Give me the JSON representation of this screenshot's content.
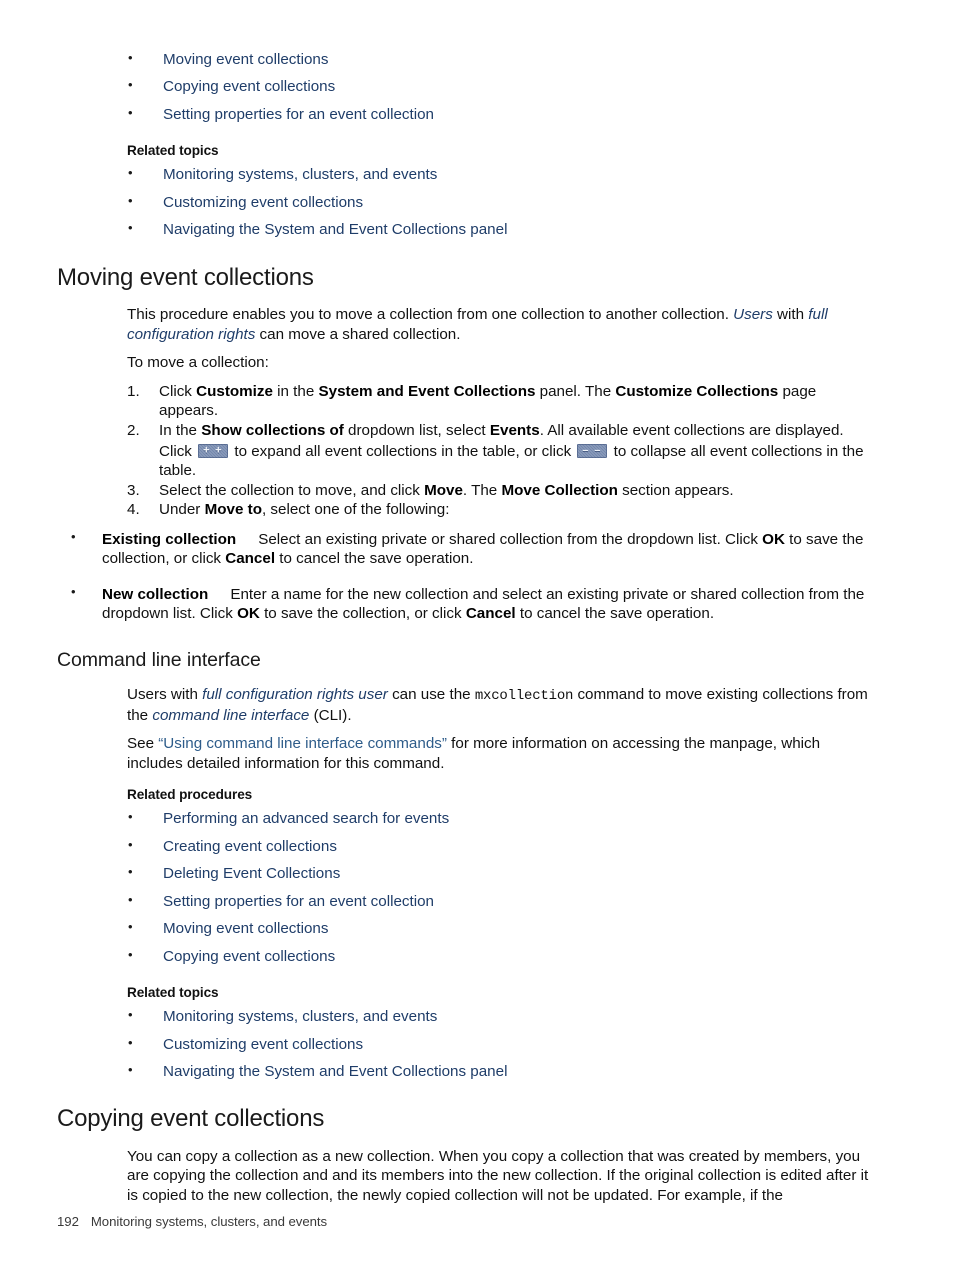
{
  "document": {
    "top_list": [
      "Moving event collections",
      "Copying event collections",
      "Setting properties for an event collection"
    ],
    "related_topics_heading": "Related topics",
    "related_procedures_heading": "Related procedures",
    "top_related_topics": [
      "Monitoring systems, clusters, and events",
      "Customizing event collections",
      "Navigating the System and Event Collections panel"
    ],
    "moving_section": {
      "title": "Moving event collections",
      "intro_1": "This procedure enables you to move a collection from one collection to another collection. ",
      "intro_link_users": "Users",
      "intro_2": " with ",
      "intro_link_rights": "full configuration rights",
      "intro_3": " can move a shared collection.",
      "lead_in": "To move a collection:",
      "steps": [
        {
          "number": "1.",
          "parts": [
            {
              "t": "Click ",
              "s": "plain"
            },
            {
              "t": "Customize",
              "s": "bold"
            },
            {
              "t": " in the ",
              "s": "plain"
            },
            {
              "t": "System and Event Collections",
              "s": "bold"
            },
            {
              "t": " panel. The ",
              "s": "plain"
            },
            {
              "t": "Customize Collections",
              "s": "bold"
            },
            {
              "t": " page appears.",
              "s": "plain"
            }
          ]
        },
        {
          "number": "2.",
          "parts": [
            {
              "t": "In the ",
              "s": "plain"
            },
            {
              "t": "Show collections of",
              "s": "bold"
            },
            {
              "t": " dropdown list, select ",
              "s": "plain"
            },
            {
              "t": "Events",
              "s": "bold"
            },
            {
              "t": ". All available event collections are displayed.",
              "s": "plain"
            }
          ],
          "extra_parts": [
            {
              "t": "Click ",
              "s": "plain"
            },
            {
              "t": "",
              "s": "icon-expand"
            },
            {
              "t": " to expand all event collections in the table, or click ",
              "s": "plain"
            },
            {
              "t": "",
              "s": "icon-collapse"
            },
            {
              "t": " to collapse all event collections in the table.",
              "s": "plain"
            }
          ]
        },
        {
          "number": "3.",
          "parts": [
            {
              "t": "Select the collection to move, and click ",
              "s": "plain"
            },
            {
              "t": "Move",
              "s": "bold"
            },
            {
              "t": ". The ",
              "s": "plain"
            },
            {
              "t": "Move Collection",
              "s": "bold"
            },
            {
              "t": " section appears.",
              "s": "plain"
            }
          ]
        },
        {
          "number": "4.",
          "parts": [
            {
              "t": "Under ",
              "s": "plain"
            },
            {
              "t": "Move to",
              "s": "bold"
            },
            {
              "t": ", select one of the following:",
              "s": "plain"
            }
          ]
        }
      ],
      "sub_bullets": [
        {
          "term": "Existing collection",
          "parts": [
            {
              "t": "Select an existing private or shared collection from the dropdown list. Click ",
              "s": "plain"
            },
            {
              "t": "OK",
              "s": "bold"
            },
            {
              "t": " to save the collection, or click ",
              "s": "plain"
            },
            {
              "t": "Cancel",
              "s": "bold"
            },
            {
              "t": " to cancel the save operation.",
              "s": "plain"
            }
          ]
        },
        {
          "term": "New collection",
          "parts": [
            {
              "t": "Enter a name for the new collection and select an existing private or shared collection from the dropdown list. Click ",
              "s": "plain"
            },
            {
              "t": "OK",
              "s": "bold"
            },
            {
              "t": " to save the collection, or click ",
              "s": "plain"
            },
            {
              "t": "Cancel",
              "s": "bold"
            },
            {
              "t": " to cancel the save operation.",
              "s": "plain"
            }
          ]
        }
      ]
    },
    "cli_section": {
      "title": "Command line interface",
      "para1_parts": [
        {
          "t": "Users with ",
          "s": "plain"
        },
        {
          "t": "full configuration rights user",
          "s": "ital-link"
        },
        {
          "t": " can use the ",
          "s": "plain"
        },
        {
          "t": "mxcollection",
          "s": "mono"
        },
        {
          "t": " command to move existing collections from the ",
          "s": "plain"
        },
        {
          "t": "command line interface",
          "s": "ital-link"
        },
        {
          "t": " (CLI).",
          "s": "plain"
        }
      ],
      "para2_parts": [
        {
          "t": "See ",
          "s": "plain"
        },
        {
          "t": "“Using command line interface commands”",
          "s": "blue-link"
        },
        {
          "t": " for more information on accessing the manpage, which includes detailed information for this command.",
          "s": "plain"
        }
      ],
      "related_procedures": [
        "Performing an advanced search for events",
        "Creating event collections",
        "Deleting Event Collections",
        "Setting properties for an event collection",
        "Moving event collections",
        "Copying event collections"
      ],
      "related_topics": [
        "Monitoring systems, clusters, and events",
        "Customizing event collections",
        "Navigating the System and Event Collections panel"
      ]
    },
    "copying_section": {
      "title": "Copying event collections",
      "paragraph": "You can copy a collection as a new collection. When you copy a collection that was created by members, you are copying the collection and and its members into the new collection. If the original collection is edited after it is copied to the new collection, the newly copied collection will not be updated. For example, if the"
    },
    "footer": {
      "page_number": "192",
      "chapter": "Monitoring systems, clusters, and events"
    },
    "icons": {
      "expand": {
        "name": "expand-all-icon",
        "glyph": "+"
      },
      "collapse": {
        "name": "collapse-all-icon",
        "glyph": "–"
      }
    },
    "colors": {
      "link_navy": "#1f3d69",
      "link_blue": "#2e5c8a",
      "icon_bg": "#7488ad",
      "text": "#111111"
    }
  }
}
